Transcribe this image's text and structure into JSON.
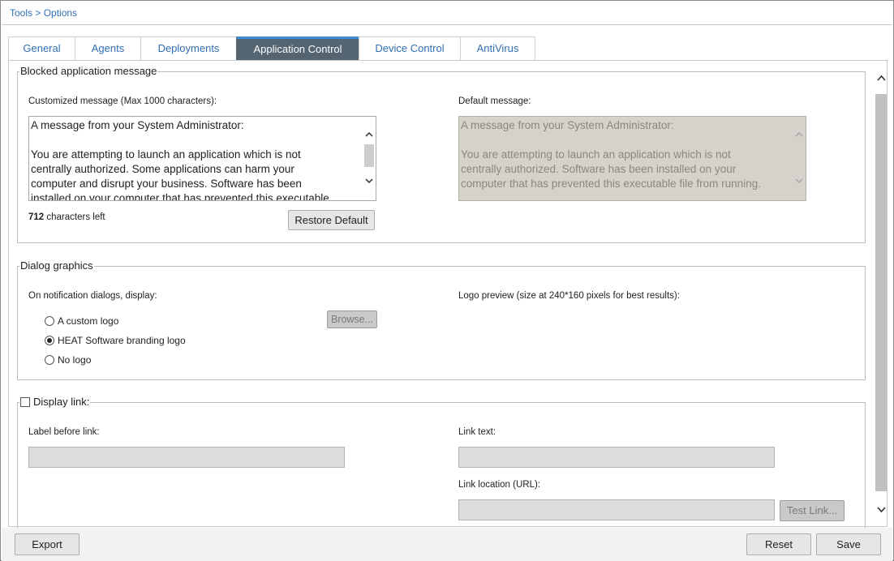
{
  "breadcrumb": "Tools > Options",
  "tabs": [
    {
      "label": "General"
    },
    {
      "label": "Agents"
    },
    {
      "label": "Deployments"
    },
    {
      "label": "Application Control"
    },
    {
      "label": "Device Control"
    },
    {
      "label": "AntiVirus"
    }
  ],
  "active_tab": "Application Control",
  "blocked": {
    "title": "Blocked application message",
    "custom_label": "Customized message (Max 1000 characters):",
    "custom_lines": [
      "A message from your System Administrator:",
      "",
      "You are attempting to launch an application which is not",
      "centrally authorized. Some applications can harm your",
      "computer and disrupt your business. Software has been",
      "installed on your computer that has prevented this executable"
    ],
    "chars_count": "712",
    "chars_suffix": " characters left",
    "restore_label": "Restore Default",
    "default_label": "Default message:",
    "default_lines": [
      "A message from your System Administrator:",
      "",
      "You are attempting to launch an application which is not",
      "centrally authorized. Software has been installed on your",
      "computer that has prevented this executable file from running."
    ]
  },
  "graphics": {
    "title": "Dialog graphics",
    "display_label": "On notification dialogs, display:",
    "options": [
      {
        "label": "A custom logo",
        "checked": false
      },
      {
        "label": "HEAT Software branding logo",
        "checked": true
      },
      {
        "label": "No logo",
        "checked": false
      }
    ],
    "browse_label": "Browse...",
    "preview_label": "Logo preview (size at 240*160 pixels for best results):"
  },
  "link": {
    "title": "Display link:",
    "checked": false,
    "label_before": "Label before link:",
    "label_before_value": "",
    "link_text": "Link text:",
    "link_text_value": "",
    "link_location": "Link location (URL):",
    "link_location_value": "",
    "test_label": "Test Link..."
  },
  "footer": {
    "export_label": "Export",
    "reset_label": "Reset",
    "save_label": "Save"
  },
  "icons": {
    "scroll_up": "chevron-up-icon",
    "scroll_down": "chevron-down-icon"
  }
}
